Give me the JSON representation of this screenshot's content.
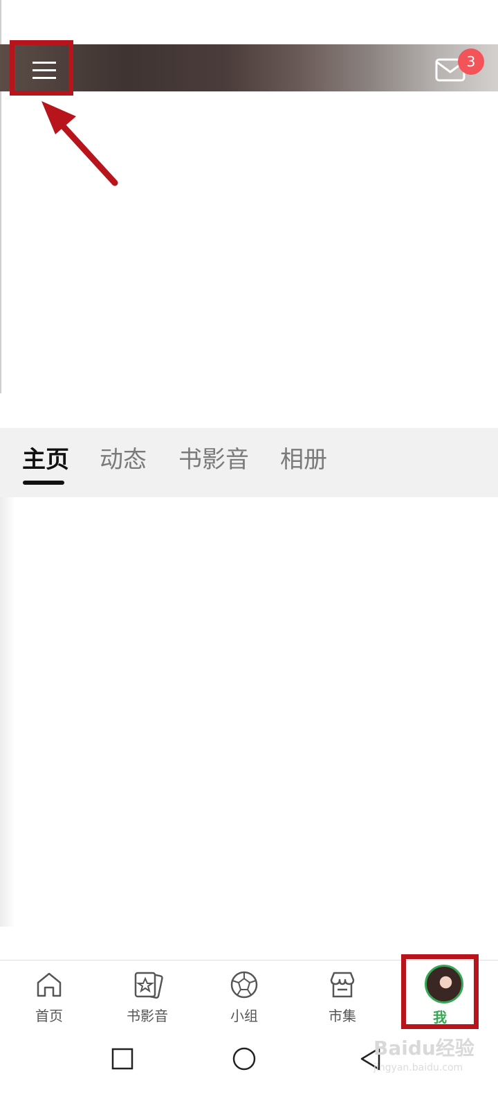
{
  "header": {
    "mail_badge_count": "3",
    "icons": {
      "menu": "menu-icon",
      "mail": "mail-icon"
    }
  },
  "profile_tabs": [
    {
      "label": "主页",
      "active": true
    },
    {
      "label": "动态",
      "active": false
    },
    {
      "label": "书影音",
      "active": false
    },
    {
      "label": "相册",
      "active": false
    }
  ],
  "bottom_nav": {
    "items": [
      {
        "label": "首页",
        "icon": "home-icon"
      },
      {
        "label": "书影音",
        "icon": "star-card-icon"
      },
      {
        "label": "小组",
        "icon": "group-ball-icon"
      },
      {
        "label": "市集",
        "icon": "market-icon"
      },
      {
        "label": "我",
        "icon": "avatar",
        "active": true
      }
    ]
  },
  "system_nav": {
    "icons": [
      "recent-apps-icon",
      "home-circle-icon",
      "back-icon"
    ]
  },
  "watermark": {
    "text": "Baidu经验",
    "sub": "jingyan.baidu.com"
  },
  "annotations": {
    "highlight_color": "#b8141b"
  },
  "colors": {
    "accent_green": "#35a853",
    "badge_red": "#f25459"
  }
}
